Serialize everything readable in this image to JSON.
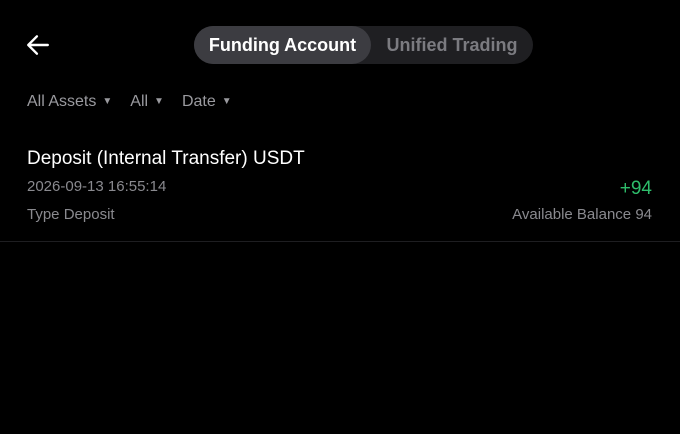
{
  "header": {
    "back_icon": "arrow-left-icon",
    "tabs": [
      {
        "label": "Funding Account",
        "active": true
      },
      {
        "label": "Unified Trading",
        "active": false
      }
    ]
  },
  "filters": [
    {
      "label": "All Assets",
      "icon": "caret-down-icon"
    },
    {
      "label": "All",
      "icon": "caret-down-icon"
    },
    {
      "label": "Date",
      "icon": "caret-down-icon"
    }
  ],
  "records": [
    {
      "title": "Deposit (Internal Transfer) USDT",
      "timestamp": "2026-09-13 16:55:14",
      "type_label": "Type",
      "type_value": "Deposit",
      "amount": "+94",
      "balance_label": "Available Balance",
      "balance_value": "94"
    }
  ],
  "colors": {
    "background": "#000000",
    "positive": "#2ebd6b",
    "muted": "#8a8a8f",
    "tab_active_bg": "#3c3c41",
    "segment_bg": "#1f1f22"
  }
}
